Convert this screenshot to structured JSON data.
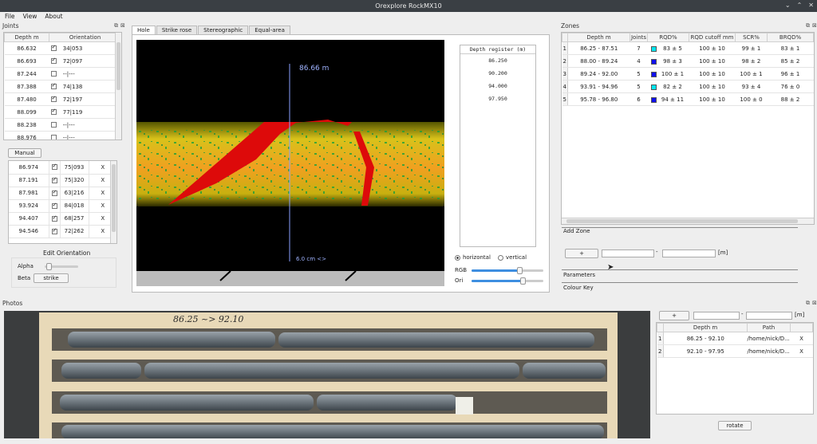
{
  "window": {
    "title": "Orexplore RockMX10"
  },
  "menu": {
    "file": "File",
    "view": "View",
    "about": "About"
  },
  "joints": {
    "title": "Joints",
    "columns": [
      "Depth m",
      "Orientation"
    ],
    "rows": [
      {
        "depth": "86.632",
        "checked": true,
        "orient": "34|053"
      },
      {
        "depth": "86.693",
        "checked": true,
        "orient": "72|097"
      },
      {
        "depth": "87.244",
        "checked": false,
        "orient": "--|---"
      },
      {
        "depth": "87.388",
        "checked": true,
        "orient": "74|138"
      },
      {
        "depth": "87.480",
        "checked": true,
        "orient": "72|197"
      },
      {
        "depth": "88.099",
        "checked": true,
        "orient": "77|119"
      },
      {
        "depth": "88.238",
        "checked": false,
        "orient": "--|---"
      },
      {
        "depth": "88.976",
        "checked": false,
        "orient": "--|---"
      }
    ],
    "manual_label": "Manual",
    "manual_rows": [
      {
        "depth": "86.974",
        "checked": true,
        "orient": "75|093",
        "x": "X"
      },
      {
        "depth": "87.191",
        "checked": true,
        "orient": "75|320",
        "x": "X"
      },
      {
        "depth": "87.981",
        "checked": true,
        "orient": "63|216",
        "x": "X"
      },
      {
        "depth": "93.924",
        "checked": true,
        "orient": "84|018",
        "x": "X"
      },
      {
        "depth": "94.407",
        "checked": true,
        "orient": "68|257",
        "x": "X"
      },
      {
        "depth": "94.546",
        "checked": true,
        "orient": "72|262",
        "x": "X"
      }
    ],
    "edit_title": "Edit Orientation",
    "alpha_label": "Alpha",
    "beta_label": "Beta",
    "strike_label": "strike"
  },
  "hole": {
    "tabs": [
      "Hole",
      "Strike rose",
      "Stereographic",
      "Equal-area"
    ],
    "depth_marker": "86.66 m",
    "scale_label": "6.0 cm  <>",
    "depth_register_title": "Depth register (m)",
    "depth_register": [
      "86.250",
      "90.200",
      "94.000",
      "97.950"
    ],
    "horizontal_label": "horizontal",
    "vertical_label": "vertical",
    "rgb_label": "RGB",
    "ori_label": "Ori",
    "rgb_level": 0.68,
    "ori_level": 0.72
  },
  "zones": {
    "title": "Zones",
    "columns": [
      "Depth m",
      "Joints",
      "RQD%",
      "RQD cutoff mm",
      "SCR%",
      "BRQD%"
    ],
    "rows": [
      {
        "n": "1",
        "depth": "86.25 - 87.51",
        "joints": "7",
        "color": "#00e5ee",
        "rqd": "83 ± 5",
        "cutoff": "100 ± 10",
        "scr": "99 ± 1",
        "brqd": "83 ± 1"
      },
      {
        "n": "2",
        "depth": "88.00 - 89.24",
        "joints": "4",
        "color": "#1010ee",
        "rqd": "98 ± 3",
        "cutoff": "100 ± 10",
        "scr": "98 ± 2",
        "brqd": "85 ± 2"
      },
      {
        "n": "3",
        "depth": "89.24 - 92.00",
        "joints": "5",
        "color": "#1010ee",
        "rqd": "100 ± 1",
        "cutoff": "100 ± 10",
        "scr": "100 ± 1",
        "brqd": "96 ± 1"
      },
      {
        "n": "4",
        "depth": "93.91 - 94.96",
        "joints": "5",
        "color": "#00e5ee",
        "rqd": "82 ± 2",
        "cutoff": "100 ± 10",
        "scr": "93 ± 4",
        "brqd": "76 ± 0"
      },
      {
        "n": "5",
        "depth": "95.78 - 96.80",
        "joints": "6",
        "color": "#1010ee",
        "rqd": "94 ± 11",
        "cutoff": "100 ± 10",
        "scr": "100 ± 0",
        "brqd": "88 ± 2"
      }
    ],
    "add_zone": "Add Zone",
    "plus": "+",
    "dash": "-",
    "unit": "[m]",
    "parameters": "Parameters",
    "colour_key": "Colour Key"
  },
  "photos": {
    "title": "Photos",
    "box_label": "86.25 ~> 92.10",
    "plus": "+",
    "dash": "-",
    "unit": "[m]",
    "columns": [
      "Depth m",
      "Path"
    ],
    "rows": [
      {
        "n": "1",
        "depth": "86.25 - 92.10",
        "path": "/home/nick/D...",
        "x": "X"
      },
      {
        "n": "2",
        "depth": "92.10 - 97.95",
        "path": "/home/nick/D...",
        "x": "X"
      }
    ],
    "rotate": "rotate"
  },
  "icons": {
    "dock_float": "float-icon",
    "dock_close": "close-icon"
  }
}
